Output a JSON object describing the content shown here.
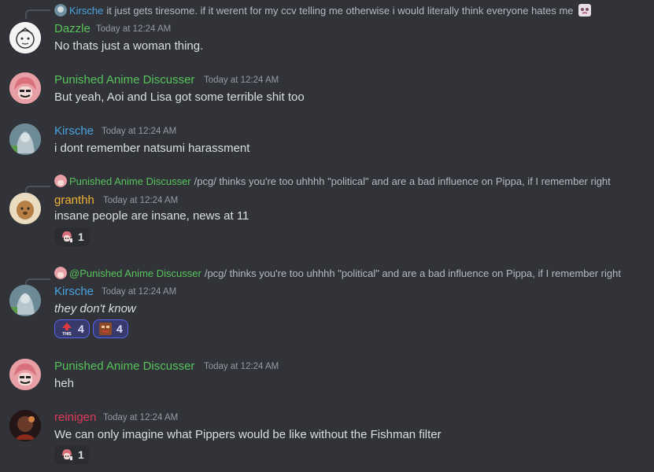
{
  "colors": {
    "background": "#313338",
    "dazzle": "#57c25b",
    "punished": "#57c25b",
    "kirsche": "#4aa3e0",
    "granthh": "#f0b232",
    "reinigen": "#e0395a",
    "timestamp": "#949ba4",
    "text": "#dbdee1"
  },
  "messages": [
    {
      "reply": {
        "author": "Kirsche",
        "text": "it just gets tiresome. if it werent for my ccv telling me otherwise i would literally think everyone hates me",
        "trailing_emoji": "crying-anime-emoji"
      },
      "author": "Dazzle",
      "timestamp": "Today at 12:24 AM",
      "text": "No thats just a woman thing."
    },
    {
      "author": "Punished Anime Discusser",
      "timestamp": "Today at 12:24 AM",
      "text": "But yeah, Aoi and Lisa got some terrible shit too"
    },
    {
      "author": "Kirsche",
      "timestamp": "Today at 12:24 AM",
      "text": "i dont remember natsumi harassment"
    },
    {
      "reply": {
        "author": "Punished Anime Discusser",
        "text": "/pcg/ thinks you're too uhhhh \"political\" and are a bad influence on Pippa, if I remember right"
      },
      "author": "granthh",
      "timestamp": "Today at 12:24 AM",
      "text": "insane people are insane, news at 11",
      "reactions": [
        {
          "emoji": "anime-girl-emoji",
          "count": "1"
        }
      ]
    },
    {
      "reply": {
        "author": "@Punished Anime Discusser",
        "text": "/pcg/ thinks you're too uhhhh \"political\" and are a bad influence on Pippa, if I remember right"
      },
      "author": "Kirsche",
      "timestamp": "Today at 12:24 AM",
      "text": "they don't know",
      "reactions": [
        {
          "emoji": "this-arrow-emoji",
          "count": "4"
        },
        {
          "emoji": "face-emoji",
          "count": "4"
        }
      ]
    },
    {
      "author": "Punished Anime Discusser",
      "timestamp": "Today at 12:24 AM",
      "text": "heh"
    },
    {
      "author": "reinigen",
      "timestamp": "Today at 12:24 AM",
      "text": "We can only imagine what Pippers would be like without the Fishman filter",
      "reactions": [
        {
          "emoji": "anime-girl-emoji",
          "count": "1"
        }
      ]
    }
  ]
}
